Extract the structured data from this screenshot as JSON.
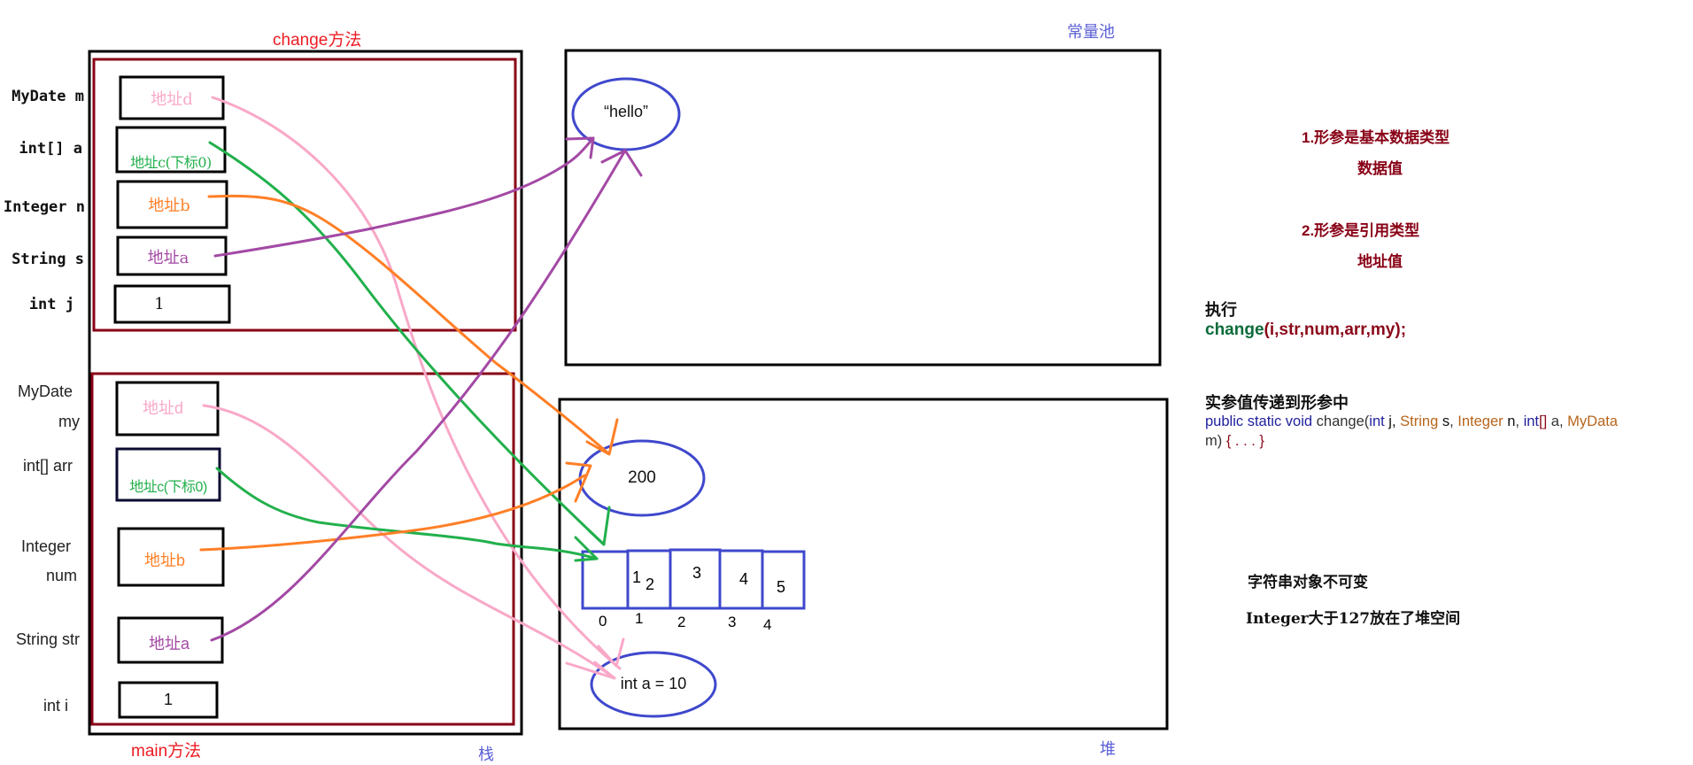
{
  "colors": {
    "frame": "#880015",
    "ellipse": "#3f48cc",
    "arrow_pink": "#f9a8c8",
    "arrow_green": "#22b04c",
    "arrow_orange": "#ff7f27",
    "arrow_purple": "#a349a4",
    "section_label": "#ed1c24",
    "area_label": "#5a5fd6"
  },
  "stack": {
    "label": "栈",
    "change_frame": {
      "label": "change方法",
      "vars": [
        {
          "name": "MyDate m",
          "value": "地址d",
          "color": "pink"
        },
        {
          "name": "int[] a",
          "value": "地址c(下标0)",
          "color": "green"
        },
        {
          "name": "Integer n",
          "value": "地址b",
          "color": "orange"
        },
        {
          "name": "String s",
          "value": "地址a",
          "color": "purple"
        },
        {
          "name": "int j",
          "value": "1",
          "color": "black"
        }
      ]
    },
    "main_frame": {
      "label": "main方法",
      "vars": [
        {
          "name_line1": "MyDate",
          "name_line2": "my",
          "value": "地址d",
          "color": "pink"
        },
        {
          "name_line1": "int[] arr",
          "name_line2": "",
          "value": "地址c(下标0)",
          "color": "green"
        },
        {
          "name_line1": "Integer",
          "name_line2": "num",
          "value": "地址b",
          "color": "orange"
        },
        {
          "name_line1": "String str",
          "name_line2": "",
          "value": "地址a",
          "color": "purple"
        },
        {
          "name_line1": "int i",
          "name_line2": "",
          "value": "1",
          "color": "black"
        }
      ]
    }
  },
  "constant_pool": {
    "label": "常量池",
    "objects": [
      {
        "text": "“hello”"
      }
    ]
  },
  "heap": {
    "label": "堆",
    "integer_object": "200",
    "array": {
      "values": [
        "1",
        "2",
        "3",
        "4",
        "5"
      ],
      "indices": [
        "0",
        "1",
        "2",
        "3",
        "4"
      ]
    },
    "mydate_object": "int a = 10"
  },
  "notes": {
    "rule1_title": "1.形参是基本数据类型",
    "rule1_value": "数据值",
    "rule2_title": "2.形参是引用类型",
    "rule2_value": "地址值",
    "execute_label": "执行",
    "call_fn": "change",
    "call_args": "(i,str,num,arr,my);",
    "pass_label": "实参值传递到形参中",
    "signature": {
      "kw": "public static void",
      "fn": " change(",
      "p1_type": "int",
      "p1_name": " j, ",
      "p2_type": "String",
      "p2_name": " s",
      "comma2": ", ",
      "p3_type": "Integer",
      "p3_name": " n",
      "comma3": ", ",
      "p4_type": "int",
      "p4_br": "[]",
      "p4_name": " a, ",
      "p5_type": "MyData",
      "line2_name": "m) ",
      "line2_body": "{ . . . }"
    },
    "immutable_note": "字符串对象不可变",
    "integer_note": "Integer大于127放在了堆空间"
  }
}
